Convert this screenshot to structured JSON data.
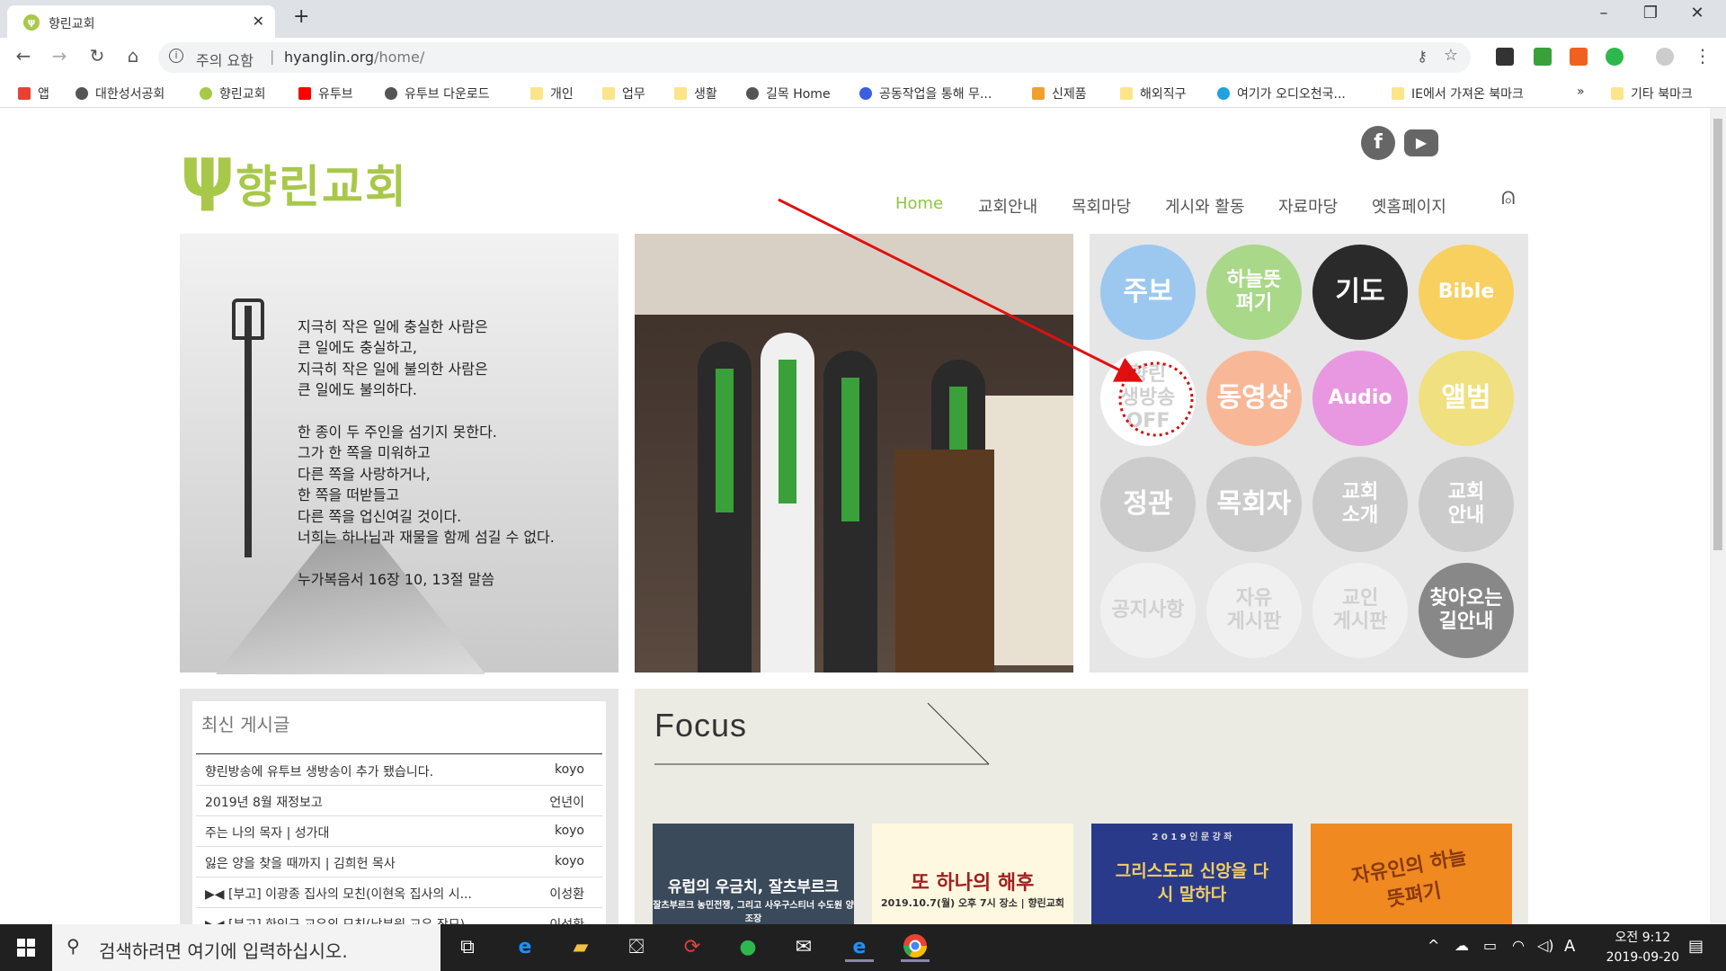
{
  "browser": {
    "tab_title": "향린교회",
    "url_warning": "주의 요함",
    "url_sep": "|",
    "url_host": "hyanglin.org",
    "url_path": "/home/"
  },
  "bookmarks": [
    {
      "label": "앱",
      "color": "#e94235"
    },
    {
      "label": "대한성서공회",
      "color": "#555555"
    },
    {
      "label": "향린교회",
      "color": "#a8c84a"
    },
    {
      "label": "유투브",
      "color": "#ff0000"
    },
    {
      "label": "유투브 다운로드",
      "color": "#555555"
    },
    {
      "label": "개인",
      "color": "#fce48a"
    },
    {
      "label": "업무",
      "color": "#fce48a"
    },
    {
      "label": "생활",
      "color": "#fce48a"
    },
    {
      "label": "길목 Home",
      "color": "#555555"
    },
    {
      "label": "공동작업을 통해 무...",
      "color": "#3b5fe0"
    },
    {
      "label": "신제품",
      "color": "#f0a030"
    },
    {
      "label": "해외직구",
      "color": "#fce48a"
    },
    {
      "label": "여기가 오디오천국...",
      "color": "#1fa3e0"
    },
    {
      "label": "IE에서 가져온 북마크",
      "color": "#fce48a"
    },
    {
      "label": "»",
      "color": ""
    },
    {
      "label": "기타 북마크",
      "color": "#fce48a"
    }
  ],
  "site": {
    "logo_text": "향린교회",
    "nav": [
      "Home",
      "교회안내",
      "목회마당",
      "게시와 활동",
      "자료마당",
      "옛홈페이지"
    ],
    "accent": "#8cc63f",
    "poem": "지극히 작은 일에 충실한 사람은\n큰 일에도 충실하고,\n지극히 작은 일에 불의한 사람은\n큰 일에도 불의하다.\n\n한 종이 두 주인을 섬기지 못한다.\n그가 한 쪽을 미워하고\n다른 쪽을 사랑하거나,\n한 쪽을 떠받들고\n다른 쪽을 업신여길 것이다.\n너희는 하나님과 재물을 함께 섬길 수 없다.\n\n누가복음서 16장 10, 13절 말씀",
    "circles": [
      {
        "label": "주보",
        "color": "#9cc8f0"
      },
      {
        "label": "하늘뜻\n펴기",
        "color": "#a8d888"
      },
      {
        "label": "기도",
        "color": "#2a2a2a"
      },
      {
        "label": "Bible",
        "color": "#f8d060"
      },
      {
        "label": "향린\n생방송\nOFF",
        "color": "#ffffff"
      },
      {
        "label": "동영상",
        "color": "#f8b898"
      },
      {
        "label": "Audio",
        "color": "#e898e0"
      },
      {
        "label": "앨범",
        "color": "#f0e080"
      },
      {
        "label": "정관",
        "color": "#cccccc"
      },
      {
        "label": "목회자",
        "color": "#cccccc"
      },
      {
        "label": "교회\n소개",
        "color": "#cccccc"
      },
      {
        "label": "교회\n안내",
        "color": "#cccccc"
      },
      {
        "label": "공지사항",
        "color": "#f0f0f0"
      },
      {
        "label": "자유\n게시판",
        "color": "#f0f0f0"
      },
      {
        "label": "교인\n게시판",
        "color": "#f0f0f0"
      },
      {
        "label": "찾아오는\n길안내",
        "color": "#888888"
      }
    ],
    "recent": {
      "heading": "최신 게시글",
      "rows": [
        {
          "title": "향린방송에 유투브 생방송이 추가 됐습니다.",
          "author": "koyo"
        },
        {
          "title": "2019년 8월 재정보고",
          "author": "언년이"
        },
        {
          "title": "주는 나의 목자 | 성가대",
          "author": "koyo"
        },
        {
          "title": "잃은 양을 찾을 때까지 | 김희헌 목사",
          "author": "koyo"
        },
        {
          "title": "▶◀ [부고] 이광종 집사의 모친(이현옥 집사의 시...",
          "author": "이성환"
        },
        {
          "title": "▶◀ [부고] 한인규 교우의 모친(남부원 교우 장모)",
          "author": "이성환"
        }
      ]
    },
    "focus": {
      "title": "Focus",
      "thumbs": [
        {
          "caption": "유럽의 우금치, 잘츠부르크",
          "sub": "잘츠부르크 농민전쟁, 그리고 사우구스티너 수도원 양조장",
          "bg": "#3a4a5a",
          "fg": "#ffffff"
        },
        {
          "caption": "또 하나의 해후",
          "sub": "2019.10.7(월) 오후 7시 장소 | 향린교회",
          "bg": "#fff8e0",
          "fg": "#a02020"
        },
        {
          "caption": "그리스도교 신앙을 다시 말하다",
          "sub": "2 0 1 9 인 문 강 좌",
          "bg": "#2a3a8a",
          "fg": "#f0d060"
        },
        {
          "caption": "자유인의 하늘뜻펴기",
          "sub": "",
          "bg": "#f08a20",
          "fg": "#8a3a10"
        }
      ]
    }
  },
  "taskbar": {
    "search_placeholder": "검색하려면 여기에 입력하십시오.",
    "time": "오전 9:12",
    "date": "2019-09-20",
    "ime": "A"
  }
}
